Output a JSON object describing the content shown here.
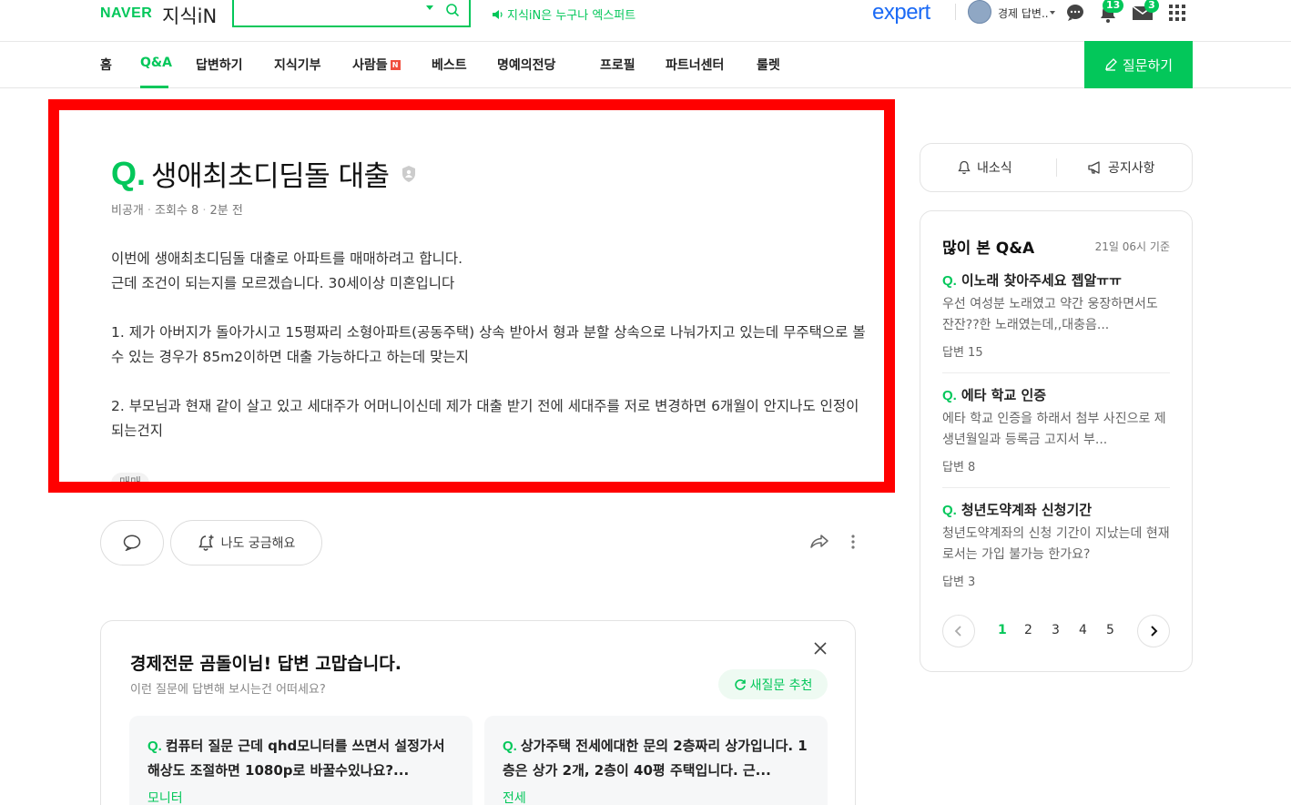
{
  "header": {
    "logo_naver": "NAVER",
    "logo_service": "지식iN",
    "search_placeholder": "",
    "promo_text": "지식iN은 누구나 엑스퍼트",
    "expert_logo": "expert",
    "user_name": "경제 답변..",
    "notification_count": "13",
    "mail_count": "3"
  },
  "nav": {
    "items": [
      "홈",
      "Q&A",
      "답변하기",
      "지식기부",
      "사람들",
      "베스트",
      "명예의전당",
      "프로필",
      "파트너센터",
      "룰렛"
    ],
    "active": "Q&A",
    "new_badge": "N",
    "ask_button": "질문하기"
  },
  "question": {
    "mark": "Q.",
    "title": "생애최초디딤돌 대출",
    "visibility": "비공개",
    "views": "조회수 8",
    "time": "2분 전",
    "body": [
      "이번에 생애최초디딤돌 대출로 아파트를 매매하려고 합니다.",
      "근데 조건이 되는지를 모르겠습니다. 30세이상 미혼입니다",
      "",
      "1. 제가 아버지가 돌아가시고 15평짜리 소형아파트(공동주택) 상속 받아서 형과 분할 상속으로 나눠가지고 있는데 무주택으로 볼 수 있는 경우가 85m2이하면 대출 가능하다고 하는데 맞는지",
      "",
      "2. 부모님과 현재 같이 살고 있고 세대주가 어머니이신데 제가 대출 받기 전에 세대주를 저로 변경하면 6개월이 안지나도 인정이 되는건지"
    ],
    "tag": "매매",
    "curious_label": "나도 궁금해요"
  },
  "answer_prompt": {
    "title": "경제전문 곰돌이님! 답변 고맙습니다.",
    "subtitle": "이런 질문에 답변해 보시는건 어떠세요?",
    "refresh_label": "새질문 추천",
    "cards": [
      {
        "mark": "Q.",
        "text": "컴퓨터 질문 근데 qhd모니터를 쓰면서 설정가서 해상도 조절하면 1080p로 바꿀수있나요?...",
        "tag": "모니터"
      },
      {
        "mark": "Q.",
        "text": "상가주택 전세에대한 문의 2층짜리 상가입니다. 1층은 상가 2개, 2층이 40평 주택입니다. 근...",
        "tag": "전세"
      }
    ]
  },
  "sidebar": {
    "my_news": "내소식",
    "notice": "공지사항",
    "popular_title": "많이 본 Q&A",
    "popular_time": "21일 06시 기준",
    "popular": [
      {
        "mark": "Q.",
        "title": "이노래 찾아주세요 젭알ㅠㅠ",
        "desc": "우선 여성분 노래였고 약간 웅장하면서도 잔잔??한 노래였는데,,대충음...",
        "answers": "답변 15"
      },
      {
        "mark": "Q.",
        "title": "에타 학교 인증",
        "desc": "에타 학교 인증을 하래서 첨부 사진으로 제 생년월일과 등록금 고지서 부...",
        "answers": "답변 8"
      },
      {
        "mark": "Q.",
        "title": "청년도약계좌 신청기간",
        "desc": "청년도약계좌의 신청 기간이 지났는데 현재로서는 가입 불가능 한가요?",
        "answers": "답변 3"
      }
    ],
    "pages": [
      "1",
      "2",
      "3",
      "4",
      "5"
    ],
    "active_page": "1"
  },
  "colors": {
    "accent": "#03c75a",
    "highlight_border": "#ff0000",
    "expert_blue": "#1b6af5"
  }
}
